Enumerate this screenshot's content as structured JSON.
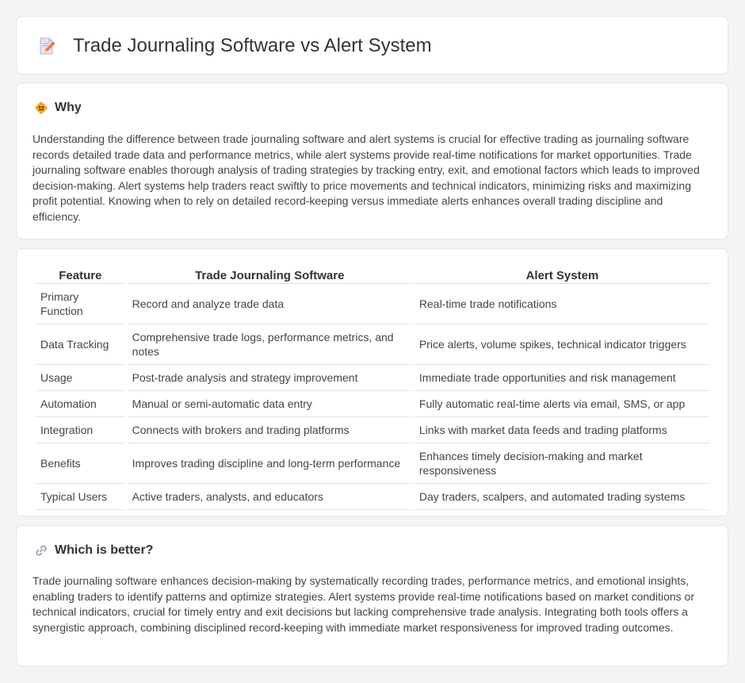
{
  "header": {
    "title": "Trade Journaling Software vs Alert System",
    "icon": "document-pencil-icon"
  },
  "why": {
    "heading": "Why",
    "icon": "diamond-sign-icon",
    "text": "Understanding the difference between trade journaling software and alert systems is crucial for effective trading as journaling software records detailed trade data and performance metrics, while alert systems provide real-time notifications for market opportunities. Trade journaling software enables thorough analysis of trading strategies by tracking entry, exit, and emotional factors which leads to improved decision-making. Alert systems help traders react swiftly to price movements and technical indicators, minimizing risks and maximizing profit potential. Knowing when to rely on detailed record-keeping versus immediate alerts enhances overall trading discipline and efficiency."
  },
  "table": {
    "headers": [
      "Feature",
      "Trade Journaling Software",
      "Alert System"
    ],
    "rows": [
      [
        "Primary Function",
        "Record and analyze trade data",
        "Real-time trade notifications"
      ],
      [
        "Data Tracking",
        "Comprehensive trade logs, performance metrics, and notes",
        "Price alerts, volume spikes, technical indicator triggers"
      ],
      [
        "Usage",
        "Post-trade analysis and strategy improvement",
        "Immediate trade opportunities and risk management"
      ],
      [
        "Automation",
        "Manual or semi-automatic data entry",
        "Fully automatic real-time alerts via email, SMS, or app"
      ],
      [
        "Integration",
        "Connects with brokers and trading platforms",
        "Links with market data feeds and trading platforms"
      ],
      [
        "Benefits",
        "Improves trading discipline and long-term performance",
        "Enhances timely decision-making and market responsiveness"
      ],
      [
        "Typical Users",
        "Active traders, analysts, and educators",
        "Day traders, scalpers, and automated trading systems"
      ]
    ]
  },
  "better": {
    "heading": "Which is better?",
    "icon": "link-icon",
    "text": "Trade journaling software enhances decision-making by systematically recording trades, performance metrics, and emotional insights, enabling traders to identify patterns and optimize strategies. Alert systems provide real-time notifications based on market conditions or technical indicators, crucial for timely entry and exit decisions but lacking comprehensive trade analysis. Integrating both tools offers a synergistic approach, combining disciplined record-keeping with immediate market responsiveness for improved trading outcomes."
  },
  "colors": {
    "background": "#f3f4f6",
    "card": "#ffffff",
    "accent_orange": "#f5a623",
    "text": "#333333"
  }
}
